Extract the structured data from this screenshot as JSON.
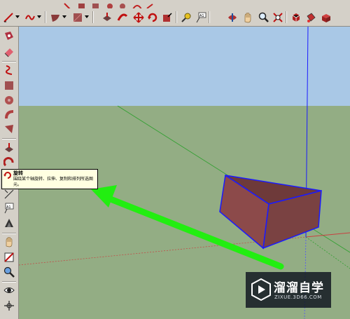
{
  "colors": {
    "sky": "#a9c8e6",
    "ground": "#93ad84",
    "axis_green": "#2fa02f",
    "axis_red": "#c84040",
    "axis_blue": "#1a1aff",
    "arrow": "#22ee11",
    "box_front": "#8c4a4a",
    "box_top": "#6e3a3a",
    "tooltip_bg": "#ffffe1"
  },
  "toolbar": {
    "icons": [
      "line-icon",
      "freehand-icon",
      "rectangle-icon",
      "circle-icon",
      "arc-icon",
      "polygon-icon",
      "push-pull-icon",
      "follow-me-icon",
      "move-icon",
      "rotate-icon",
      "scale-icon",
      "tape-measure-icon",
      "dimension-icon",
      "text-icon",
      "orbit-icon",
      "pan-icon",
      "zoom-icon",
      "zoom-extents-icon",
      "model-info-icon",
      "paint-bucket-icon",
      "components-icon"
    ]
  },
  "left_toolbar": {
    "icons": [
      "make-component-icon",
      "eraser-icon",
      "freehand-icon",
      "rectangle-icon",
      "circle-icon",
      "arc-icon",
      "polygon-icon",
      "push-pull-icon",
      "follow-me-icon",
      "rotate-icon",
      "scale-icon",
      "dimension-icon",
      "text-icon",
      "protractor-icon",
      "axes-icon",
      "section-plane-icon",
      "look-around-icon",
      "walk-icon",
      "position-camera-icon",
      "orbit-icon"
    ]
  },
  "tooltip": {
    "title": "旋转",
    "description": "围绕某个轴旋转、拉伸、复制和排列所选图元。"
  },
  "watermark": {
    "title": "溜溜自学",
    "subtitle": "ZIXUE.3D66.COM"
  }
}
